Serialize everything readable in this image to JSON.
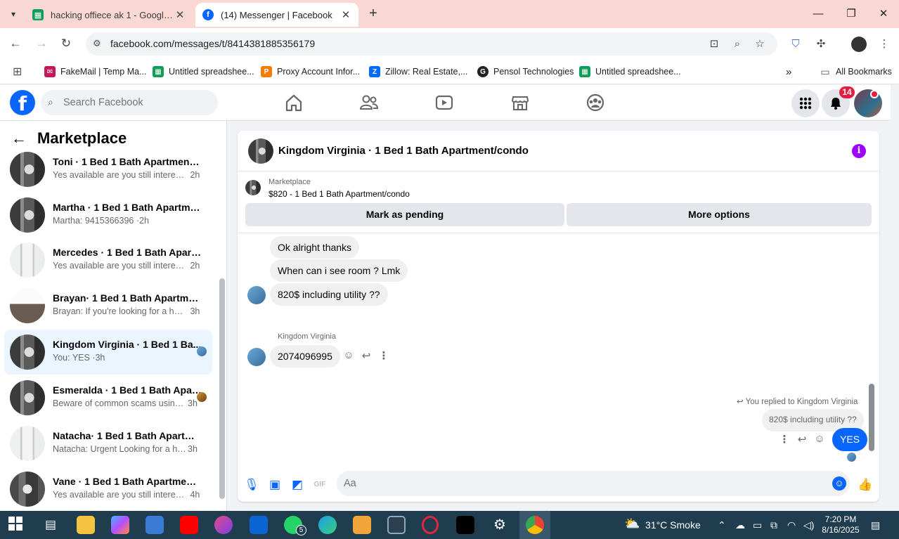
{
  "browser": {
    "tabs": [
      {
        "title": "hacking offiece ak 1 - Google D",
        "favicon": "sheets-icon"
      },
      {
        "title": "(14) Messenger | Facebook",
        "favicon": "facebook-icon"
      }
    ],
    "url": "facebook.com/messages/t/8414381885356179",
    "bookmarks": [
      {
        "label": "FakeMail | Temp Ma...",
        "color": "#c2185b"
      },
      {
        "label": "Untitled spreadshee...",
        "color": "#0f9d58"
      },
      {
        "label": "Proxy Account Infor...",
        "color": "#f57c00"
      },
      {
        "label": "Zillow: Real Estate,...",
        "color": "#006aff"
      },
      {
        "label": "Pensol Technologies",
        "color": "#222222"
      },
      {
        "label": "Untitled spreadshee...",
        "color": "#0f9d58"
      }
    ],
    "all_bookmarks": "All Bookmarks"
  },
  "fb": {
    "search_placeholder": "Search Facebook",
    "notifications_count": "14",
    "accent": "#0866ff"
  },
  "sidebar": {
    "title": "Marketplace",
    "conversations": [
      {
        "name": "Toni · 1 Bed 1 Bath Apartment/c...",
        "preview": "Yes available are you still interested...",
        "time": "2h",
        "active": false
      },
      {
        "name": "Martha · 1 Bed 1 Bath Apartmen...",
        "preview": "Martha: 9415366396 ·",
        "time": "2h",
        "active": false
      },
      {
        "name": "Mercedes · 1 Bed 1 Bath Apartm...",
        "preview": "Yes available are you still interested...",
        "time": "2h",
        "active": false
      },
      {
        "name": "Brayan· 1 Bed 1 Bath Apartment...",
        "preview": "Brayan: If you're looking for a hous...",
        "time": "3h",
        "active": false
      },
      {
        "name": "Kingdom Virginia · 1 Bed 1 Ba...",
        "preview": "You: YES ·",
        "time": "3h",
        "active": true
      },
      {
        "name": "Esmeralda · 1 Bed 1 Bath Apar...",
        "preview": "Beware of common scams using... ·",
        "time": "3h",
        "active": false
      },
      {
        "name": "Natacha· 1 Bed 1 Bath Apartmen...",
        "preview": "Natacha: Urgent Looking for a hou... ·",
        "time": "3h",
        "active": false
      },
      {
        "name": "Vane · 1 Bed 1 Bath Apartment/c...",
        "preview": "Yes available are you still interested...",
        "time": "4h",
        "active": false
      }
    ]
  },
  "chat": {
    "title": "Kingdom Virginia · 1 Bed 1 Bath Apartment/condo",
    "listing_label": "Marketplace",
    "listing_price": "$820 - 1 Bed 1 Bath Apartment/condo",
    "mark_pending": "Mark as pending",
    "more_options": "More options",
    "messages": [
      {
        "text": "Ok alright thanks"
      },
      {
        "text": "When can i see room ? Lmk"
      },
      {
        "text": "820$ including utility ??"
      }
    ],
    "sender_name": "Kingdom Virginia",
    "last_incoming": "2074096995",
    "reply_note": "You replied to Kingdom Virginia",
    "quoted": "820$ including utility ??",
    "my_reply": "YES",
    "composer_placeholder": "Aa"
  },
  "taskbar": {
    "weather": "31°C  Smoke",
    "time": "7:20 PM",
    "date": "8/16/2025",
    "whatsapp_badge": "5"
  }
}
